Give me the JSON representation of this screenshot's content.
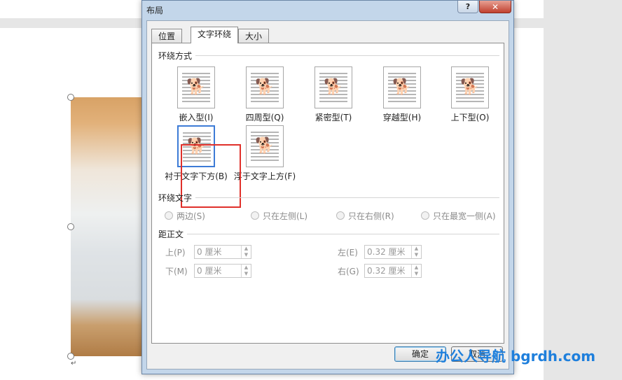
{
  "dialog": {
    "title": "布局",
    "help_label": "?",
    "close_label": "✕"
  },
  "tabs": [
    {
      "label": "位置"
    },
    {
      "label": "文字环绕"
    },
    {
      "label": "大小"
    }
  ],
  "wrap_style": {
    "section_label": "环绕方式",
    "options": [
      {
        "label": "嵌入型(I)",
        "icon": "dog-icon",
        "selected": false
      },
      {
        "label": "四周型(Q)",
        "icon": "dog-icon",
        "selected": false
      },
      {
        "label": "紧密型(T)",
        "icon": "dog-icon",
        "selected": false
      },
      {
        "label": "穿越型(H)",
        "icon": "dog-icon",
        "selected": false
      },
      {
        "label": "上下型(O)",
        "icon": "dog-icon",
        "selected": false
      },
      {
        "label": "衬于文字下方(B)",
        "icon": "dog-icon",
        "selected": true
      },
      {
        "label": "浮于文字上方(F)",
        "icon": "dog-icon",
        "selected": false
      }
    ],
    "highlight_color": "#e0302a"
  },
  "wrap_text": {
    "section_label": "环绕文字",
    "options": [
      {
        "label": "两边(S)"
      },
      {
        "label": "只在左侧(L)"
      },
      {
        "label": "只在右侧(R)"
      },
      {
        "label": "只在最宽一侧(A)"
      }
    ]
  },
  "distance": {
    "section_label": "距正文",
    "top": {
      "label": "上(P)",
      "value": "0 厘米"
    },
    "bottom": {
      "label": "下(M)",
      "value": "0 厘米"
    },
    "left": {
      "label": "左(E)",
      "value": "0.32 厘米"
    },
    "right": {
      "label": "右(G)",
      "value": "0.32 厘米"
    }
  },
  "buttons": {
    "ok": "确定",
    "cancel": "取消"
  },
  "watermark": "办公人导航 bgrdh.com",
  "colors": {
    "dialog_frame": "#c3d6ea",
    "close_button": "#c0412f",
    "watermark": "#1e7fdc"
  }
}
